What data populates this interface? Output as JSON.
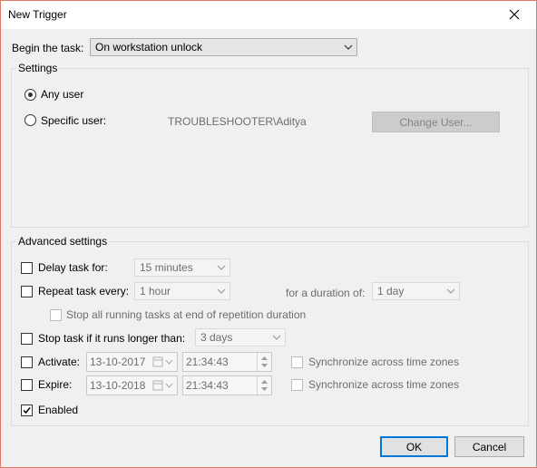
{
  "window": {
    "title": "New Trigger"
  },
  "begin": {
    "label": "Begin the task:",
    "value": "On workstation unlock"
  },
  "settings": {
    "legend": "Settings",
    "any_user": "Any user",
    "specific_user": "Specific user:",
    "user_name": "TROUBLESHOOTER\\Aditya",
    "change_user": "Change User..."
  },
  "advanced": {
    "legend": "Advanced settings",
    "delay_label": "Delay task for:",
    "delay_value": "15 minutes",
    "repeat_label": "Repeat task every:",
    "repeat_value": "1 hour",
    "duration_label": "for a duration of:",
    "duration_value": "1 day",
    "stop_all_label": "Stop all running tasks at end of repetition duration",
    "stop_longer_label": "Stop task if it runs longer than:",
    "stop_longer_value": "3 days",
    "activate_label": "Activate:",
    "activate_date": "13-10-2017",
    "activate_time": "21:34:43",
    "expire_label": "Expire:",
    "expire_date": "13-10-2018",
    "expire_time": "21:34:43",
    "sync_label": "Synchronize across time zones",
    "enabled_label": "Enabled"
  },
  "buttons": {
    "ok": "OK",
    "cancel": "Cancel"
  }
}
